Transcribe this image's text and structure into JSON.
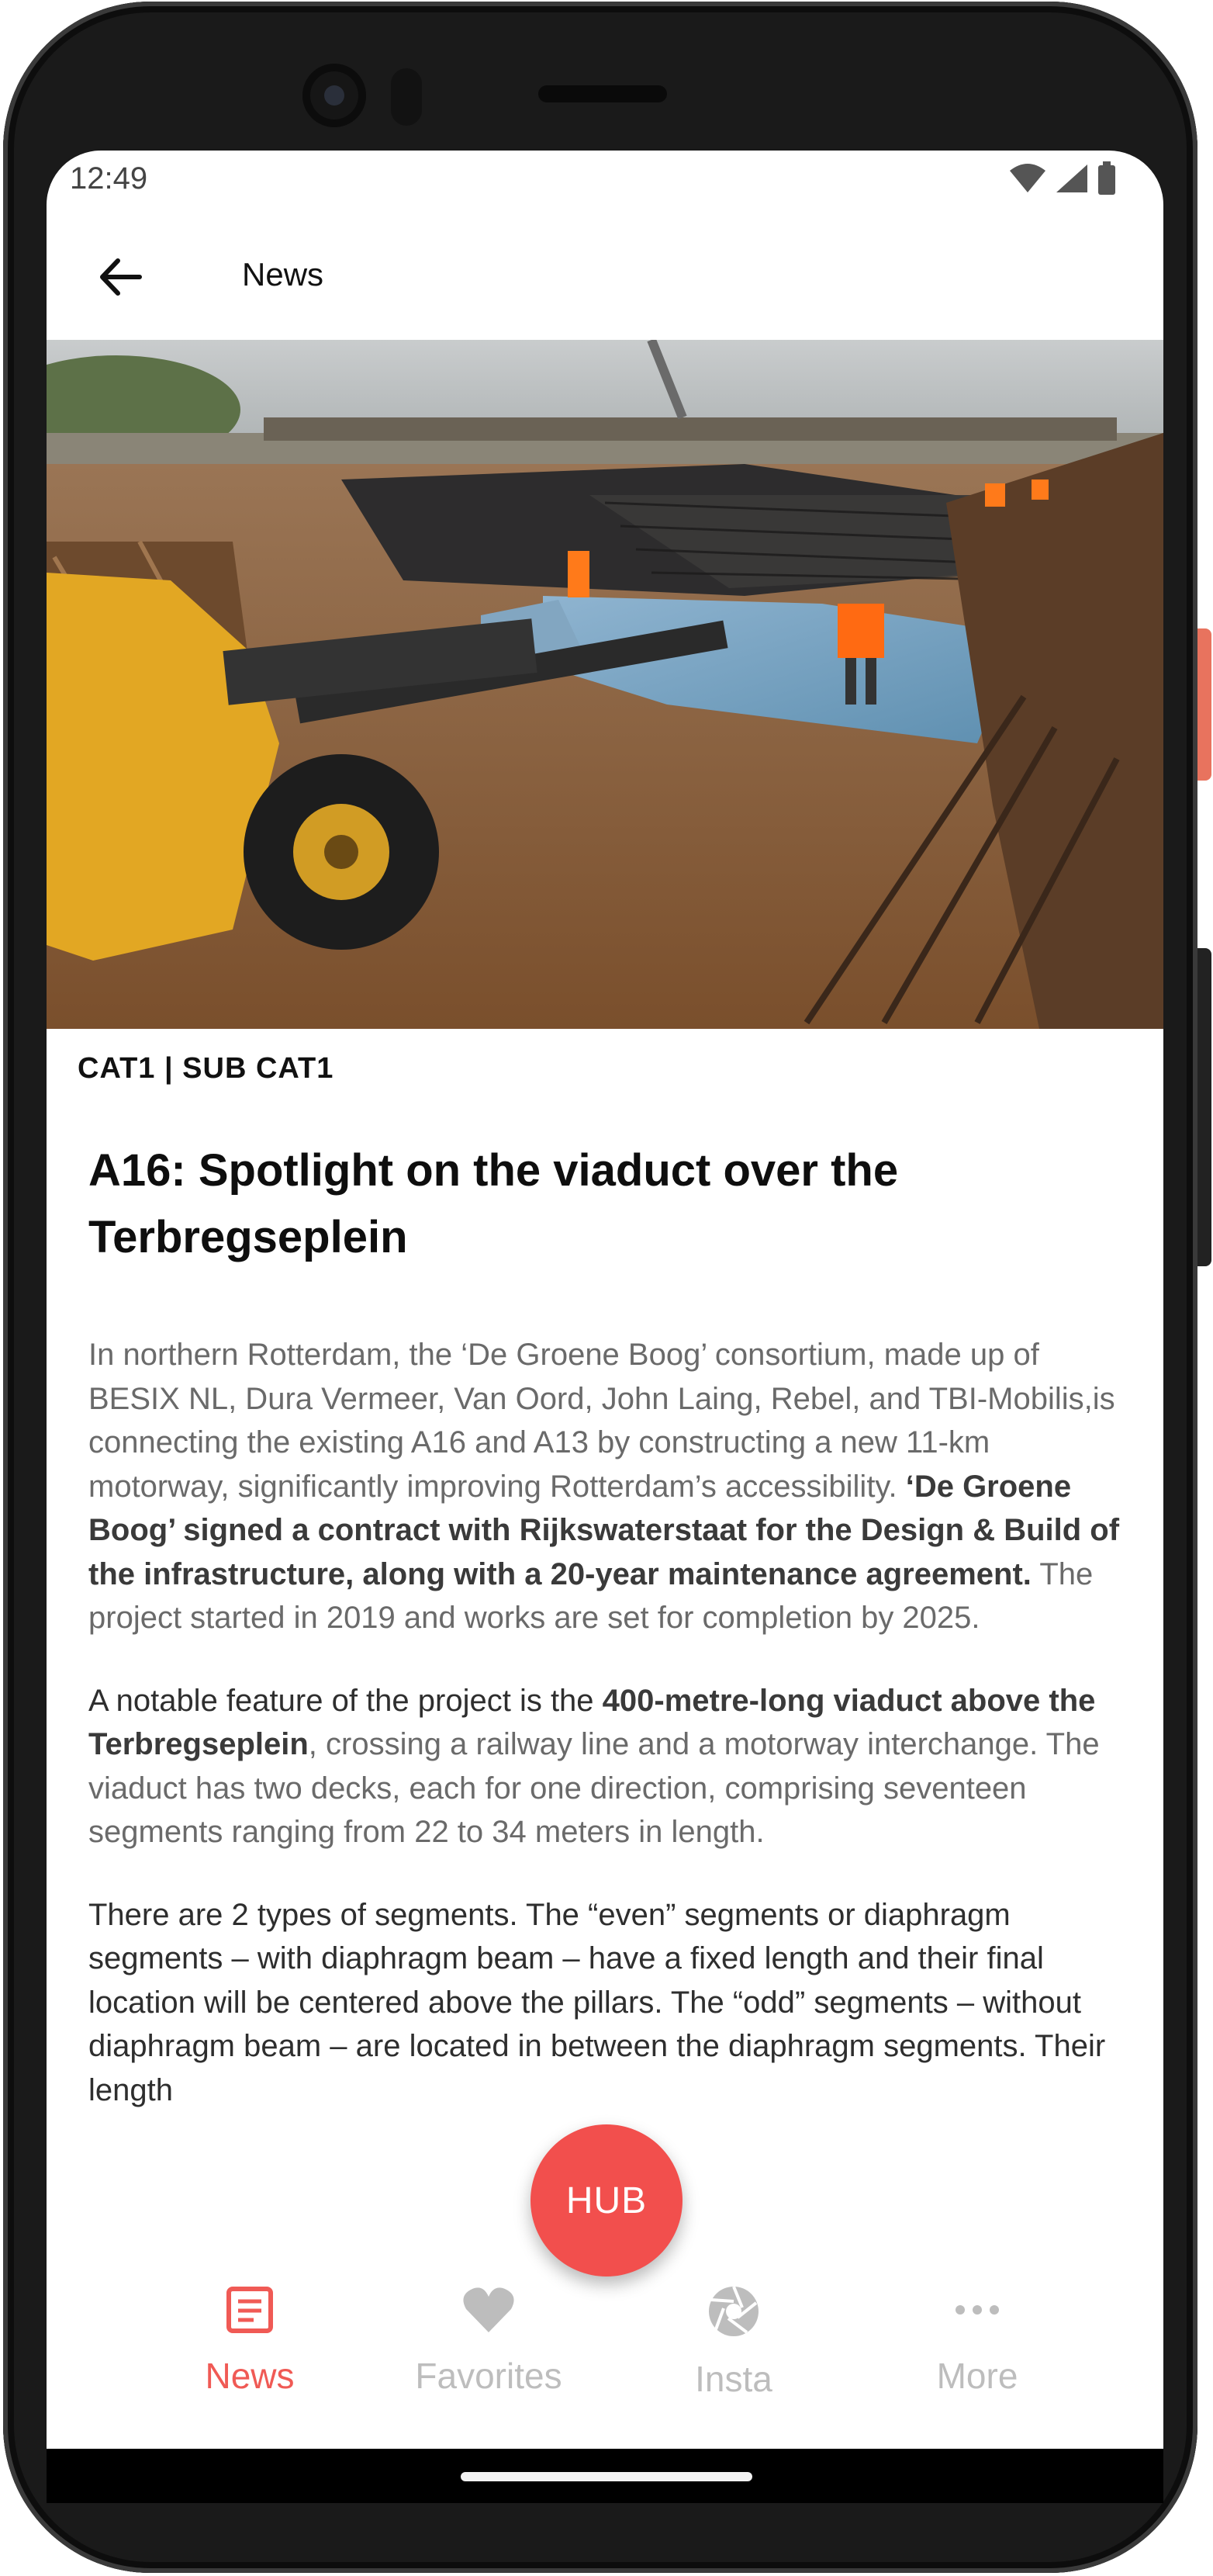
{
  "status_bar": {
    "time": "12:49"
  },
  "app_bar": {
    "title": "News"
  },
  "article": {
    "category": "CAT1 | SUB CAT1",
    "title": "A16: Spotlight on the viaduct over the Terbregseplein",
    "p1_a": "In northern Rotterdam, the ‘De Groene Boog’ consortium, made up of BESIX NL, Dura Vermeer, Van Oord, John Laing, Rebel, and TBI-Mobilis,is connecting the existing A16 and A13 by constructing a new 11-km motorway, significantly improving Rotterdam’s accessibility. ",
    "p1_b": "‘De Groene Boog’ signed a contract with Rijkswaterstaat for the Design & Build of the infrastructure, along with a 20-year maintenance agreement.",
    "p1_c": " The project started in 2019 and works are set for completion by 2025.",
    "p2_a": "A notable feature of the project is the ",
    "p2_b": "400-metre-long viaduct above the Terbregseplein",
    "p2_c": ", crossing a railway line and a motorway interchange. The viaduct has two decks, each for one direction, comprising seventeen segments ranging from 22 to 34 meters in length.",
    "p3": "There are 2 types of segments. The “even” segments or diaphragm segments – with diaphragm beam – have a fixed length and their final location will be centered above the pillars. The “odd” segments – without diaphragm beam – are located in between the diaphragm segments. Their length"
  },
  "fab": {
    "label": "HUB"
  },
  "bottom_nav": {
    "items": [
      {
        "label": "News",
        "icon": "news-icon",
        "active": true
      },
      {
        "label": "Favorites",
        "icon": "heart-icon",
        "active": false
      },
      {
        "label": "Insta",
        "icon": "camera-aperture-icon",
        "active": false
      },
      {
        "label": "More",
        "icon": "more-dots-icon",
        "active": false
      }
    ]
  },
  "colors": {
    "accent": "#f24f4d",
    "inactive": "#bdbdbd",
    "text": "#111111"
  }
}
